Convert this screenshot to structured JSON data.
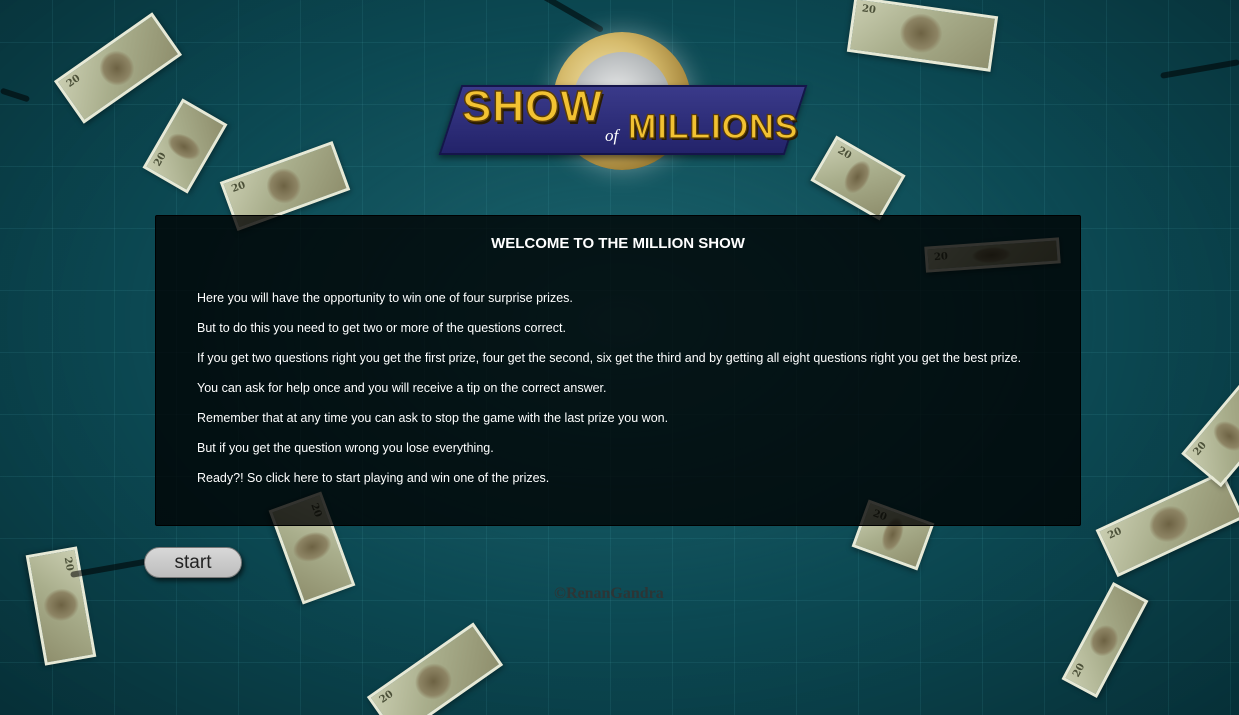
{
  "logo": {
    "show": "SHOW",
    "of": "of",
    "millions": "MILLIONS"
  },
  "intro": {
    "title": "WELCOME TO THE MILLION SHOW",
    "lines": [
      "Here you will have the opportunity to win one of four surprise prizes.",
      "But to do this you need to get two or more of the questions correct.",
      "If you get two questions right you get the first prize, four get the second, six get the third and by getting all eight questions right you get the best prize.",
      "You can ask for help once and you will receive a tip on the correct answer.",
      "Remember that at any time you can ask to stop the game with the last prize you won.",
      "But if you get the question wrong you lose everything.",
      "Ready?! So click here to start playing and win one of the prizes."
    ]
  },
  "start_button": {
    "label": "start"
  },
  "footer": {
    "copyright": "©RenanGandra"
  },
  "colors": {
    "background": "#0c4b55",
    "logo_gold": "#f2c232",
    "logo_banner": "#2a2a78",
    "panel": "#000000"
  }
}
